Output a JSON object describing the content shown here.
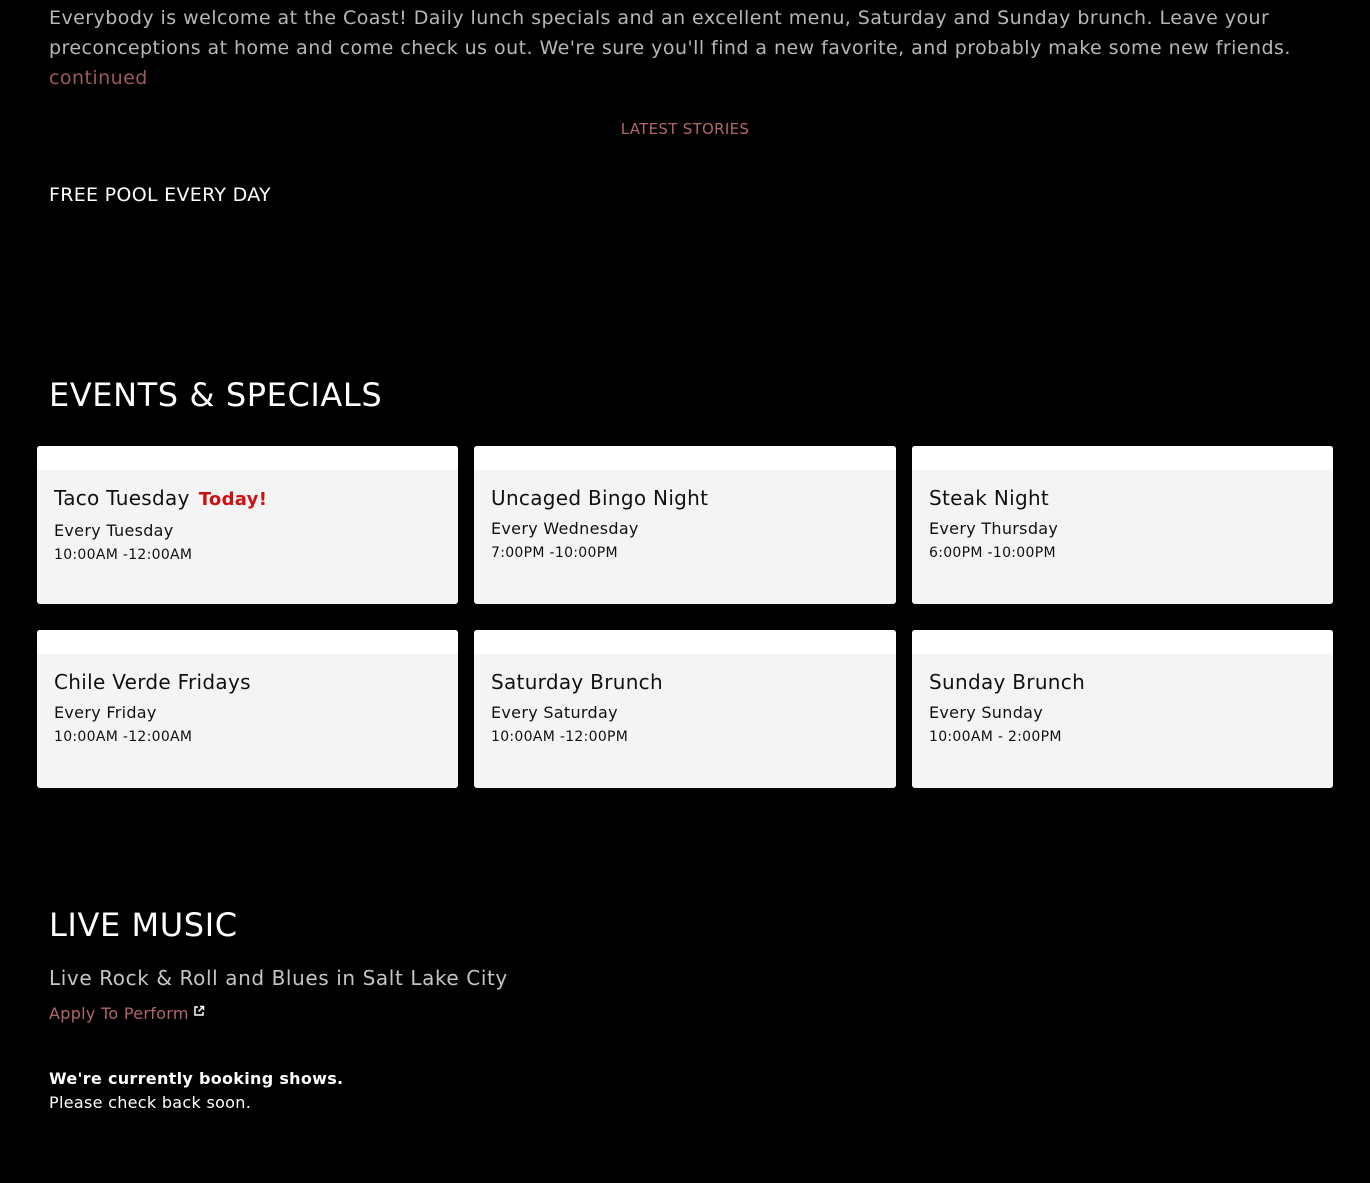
{
  "intro": {
    "text": "Everybody is welcome at the Coast! Daily lunch specials and an excellent menu, Saturday and Sunday brunch. Leave your preconceptions at home and come check us out. We're sure you'll find a new favorite, and probably make some new friends.",
    "continued_label": "continued"
  },
  "latest_stories": {
    "label": "LATEST STORIES",
    "stories": [
      "FREE POOL EVERY DAY"
    ]
  },
  "events": {
    "heading": "EVENTS & SPECIALS",
    "cards": [
      {
        "title": "Taco Tuesday",
        "badge": "Today!",
        "day": "Every Tuesday",
        "time": "10:00AM -12:00AM"
      },
      {
        "title": "Uncaged Bingo Night",
        "badge": "",
        "day": "Every Wednesday",
        "time": "7:00PM -10:00PM"
      },
      {
        "title": "Steak Night",
        "badge": "",
        "day": "Every Thursday",
        "time": "6:00PM -10:00PM"
      },
      {
        "title": "Chile Verde Fridays",
        "badge": "",
        "day": "Every Friday",
        "time": "10:00AM -12:00AM"
      },
      {
        "title": "Saturday Brunch",
        "badge": "",
        "day": "Every Saturday",
        "time": "10:00AM -12:00PM"
      },
      {
        "title": "Sunday Brunch",
        "badge": "",
        "day": "Every Sunday",
        "time": "10:00AM - 2:00PM"
      }
    ]
  },
  "live_music": {
    "heading": "LIVE MUSIC",
    "subtitle": "Live Rock & Roll and Blues in Salt Lake City",
    "apply_label": "Apply To Perform",
    "apply_icon": "external-link-icon",
    "booking_bold": "We're currently booking shows.",
    "booking_note": "Please check back soon."
  },
  "colors": {
    "background": "#000000",
    "accent": "#b3676b",
    "today_badge": "#cc1111",
    "card_background": "#f4f4f4"
  }
}
